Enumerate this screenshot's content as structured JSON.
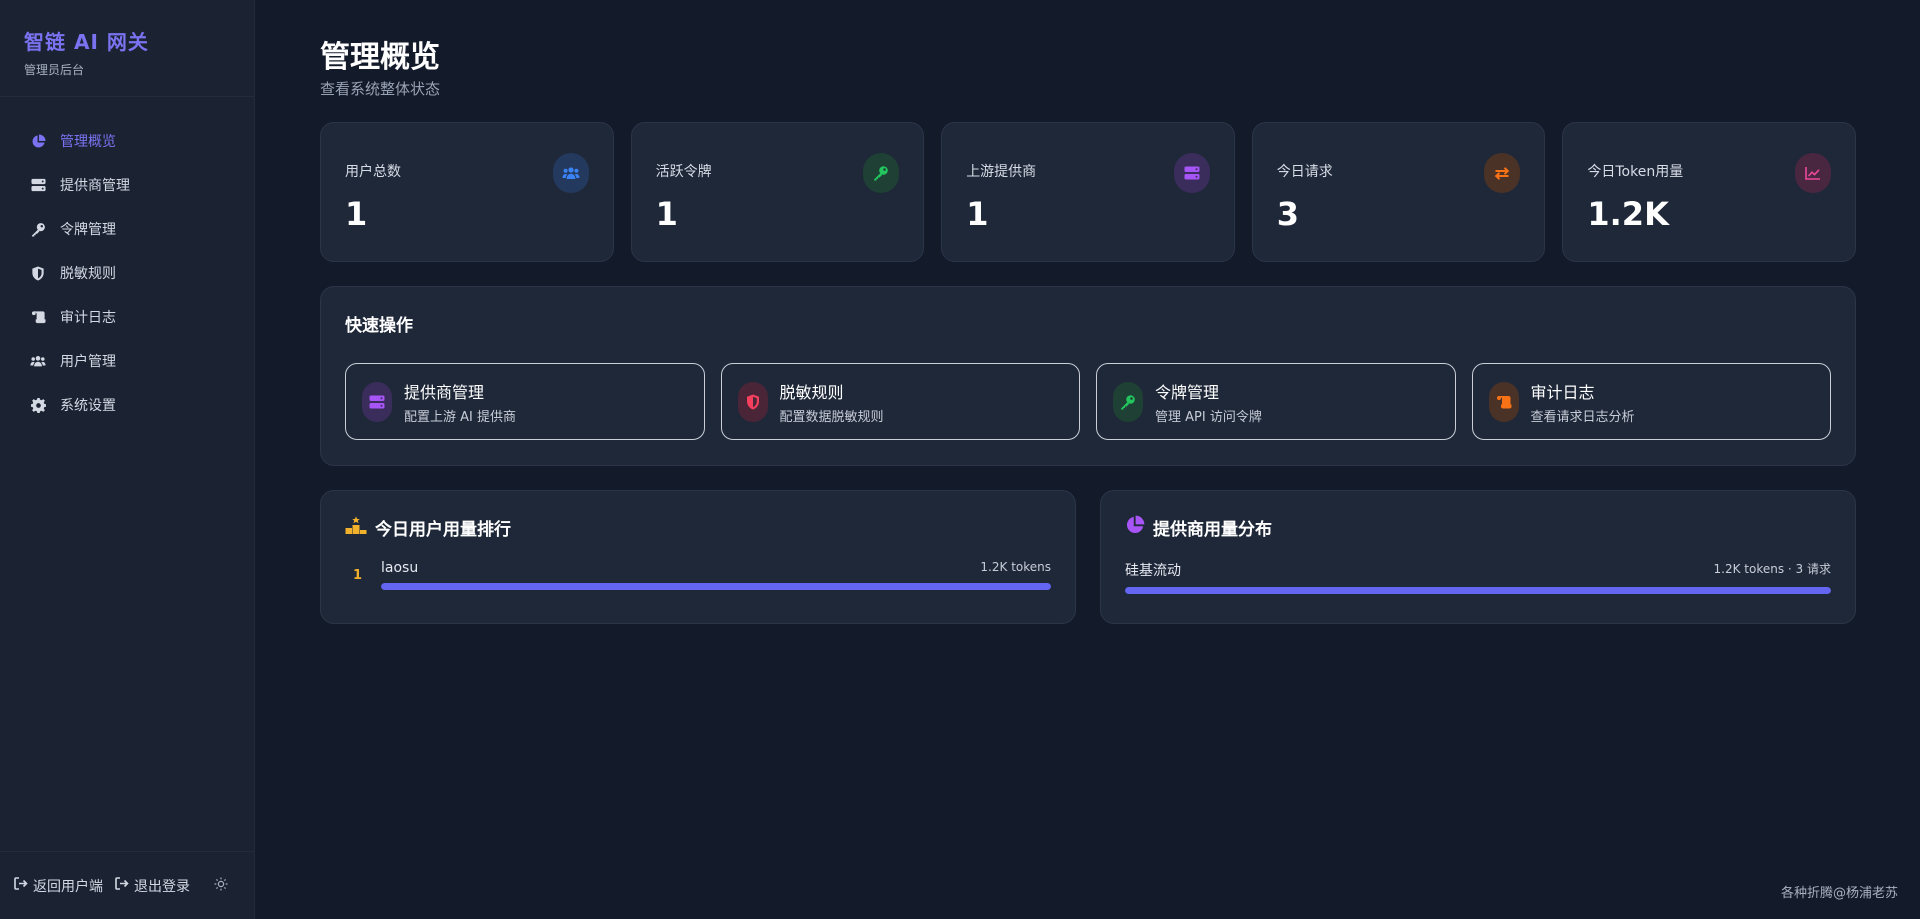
{
  "brand": {
    "title": "智链 AI 网关",
    "subtitle": "管理员后台"
  },
  "sidebar": {
    "items": [
      {
        "label": "管理概览",
        "icon": "pie-chart-icon",
        "active": true
      },
      {
        "label": "提供商管理",
        "icon": "server-icon"
      },
      {
        "label": "令牌管理",
        "icon": "key-icon"
      },
      {
        "label": "脱敏规则",
        "icon": "shield-icon"
      },
      {
        "label": "审计日志",
        "icon": "scroll-icon"
      },
      {
        "label": "用户管理",
        "icon": "users-icon"
      },
      {
        "label": "系统设置",
        "icon": "gear-icon"
      }
    ],
    "footer": {
      "back_label": "返回用户端",
      "logout_label": "退出登录",
      "theme_icon": "sun-icon"
    }
  },
  "page": {
    "title": "管理概览",
    "subtitle": "查看系统整体状态"
  },
  "stats": [
    {
      "label": "用户总数",
      "value": "1",
      "icon": "users-icon",
      "color": "#3b82f6",
      "bg": "#233a5e"
    },
    {
      "label": "活跃令牌",
      "value": "1",
      "icon": "key-icon",
      "color": "#22c55e",
      "bg": "#1f4034"
    },
    {
      "label": "上游提供商",
      "value": "1",
      "icon": "server-icon",
      "color": "#a855f7",
      "bg": "#3a2d5c"
    },
    {
      "label": "今日请求",
      "value": "3",
      "icon": "exchange-icon",
      "color": "#f97316",
      "bg": "#4a3226"
    },
    {
      "label": "今日Token用量",
      "value": "1.2K",
      "icon": "line-chart-icon",
      "color": "#ec4899",
      "bg": "#4a2741"
    }
  ],
  "quick": {
    "title": "快速操作",
    "items": [
      {
        "title": "提供商管理",
        "desc": "配置上游 AI 提供商",
        "icon": "server-icon",
        "color": "#a855f7",
        "bg": "#3a2d5c"
      },
      {
        "title": "脱敏规则",
        "desc": "配置数据脱敏规则",
        "icon": "shield-icon",
        "color": "#f43f5e",
        "bg": "#4a2537"
      },
      {
        "title": "令牌管理",
        "desc": "管理 API 访问令牌",
        "icon": "key-icon",
        "color": "#22c55e",
        "bg": "#1f4034"
      },
      {
        "title": "审计日志",
        "desc": "查看请求日志分析",
        "icon": "scroll-icon",
        "color": "#f97316",
        "bg": "#4a3226"
      }
    ]
  },
  "ranking": {
    "title": "今日用户用量排行",
    "icon": "podium-icon",
    "rows": [
      {
        "rank": "1",
        "name": "laosu",
        "value": "1.2K tokens",
        "fill": 1.0
      }
    ]
  },
  "distribution": {
    "title": "提供商用量分布",
    "icon": "pie-chart-icon",
    "rows": [
      {
        "name": "硅基流动",
        "value": "1.2K tokens · 3 请求",
        "fill": 1.0
      }
    ]
  },
  "watermark": "各种折腾@杨浦老苏"
}
